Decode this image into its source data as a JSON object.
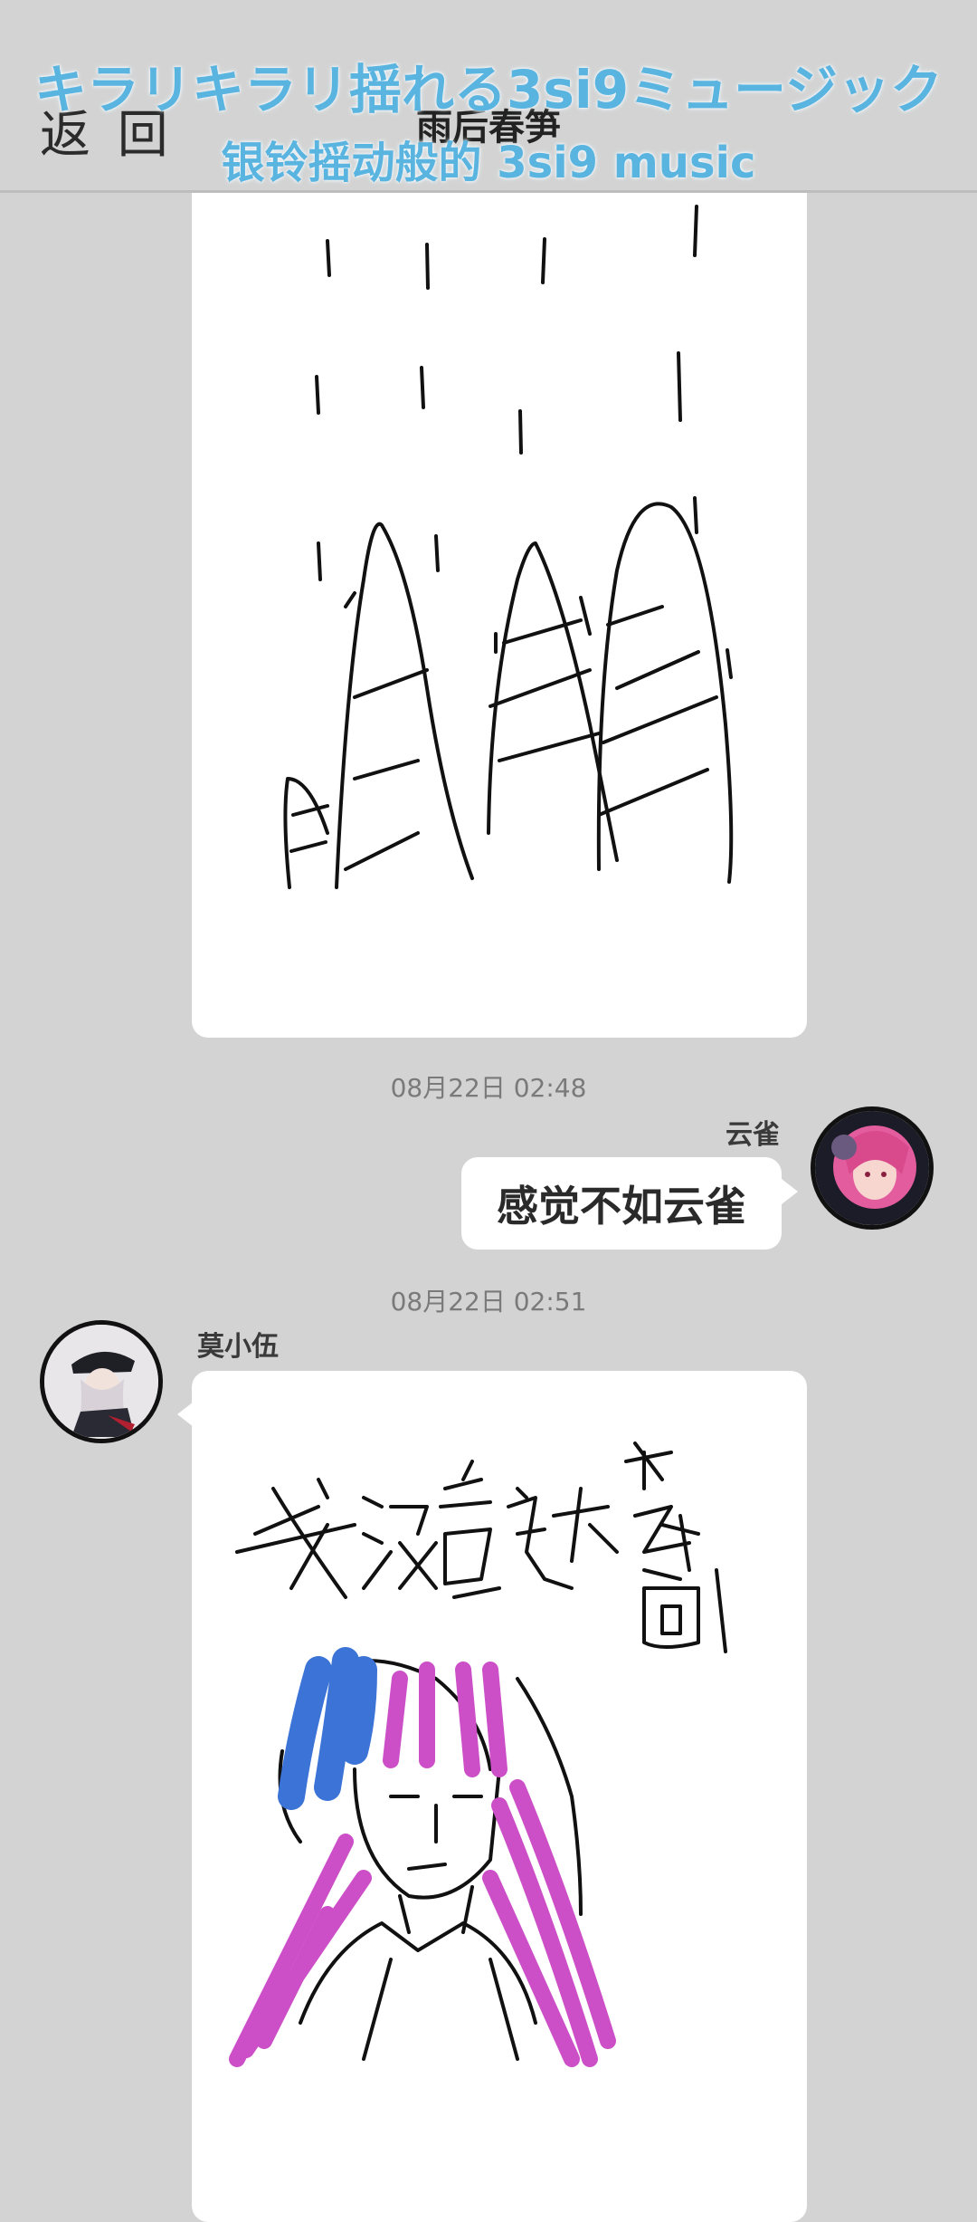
{
  "header": {
    "back_label": "返 回",
    "title": "雨后春笋",
    "banner_line1": "キラリキラリ揺れる3si9ミュージック",
    "banner_line2": "银铃摇动般的 3si9 music"
  },
  "messages": [
    {
      "type": "drawing",
      "sender": "",
      "side": "left"
    },
    {
      "timestamp": "08月22日  02:48",
      "sender": "云雀",
      "side": "right",
      "text": "感觉不如云雀",
      "avatar_icon": "user-avatar-pink-hair"
    },
    {
      "timestamp": "08月22日  02:51",
      "sender": "莫小伍",
      "side": "left",
      "type": "drawing",
      "drawing_text": "我没看过这个 动画",
      "avatar_icon": "user-avatar-captain-hat"
    }
  ],
  "colors": {
    "background": "#d3d3d3",
    "banner": "#5ab4e0",
    "bubble": "#ffffff",
    "drawing_blue": "#3b73d6",
    "drawing_magenta": "#cc4fc7"
  }
}
